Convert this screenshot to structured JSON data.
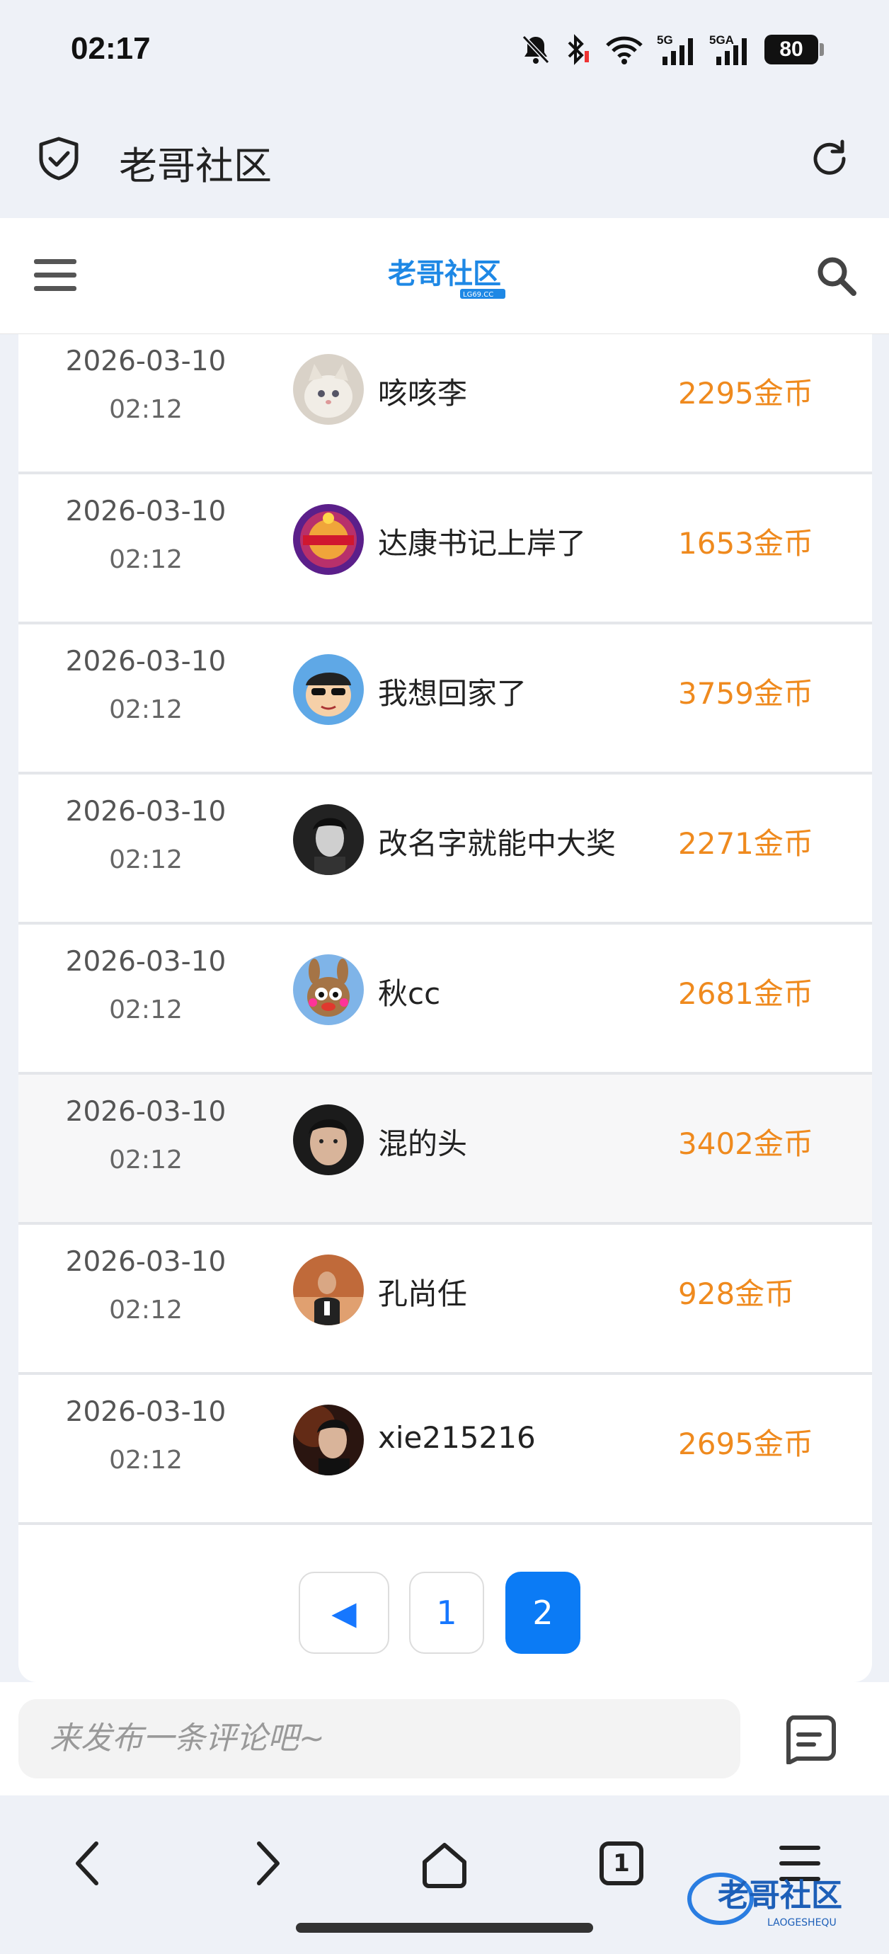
{
  "status_bar": {
    "time": "02:17",
    "battery": "80",
    "signal_a": "5G",
    "signal_b": "5GA"
  },
  "browser": {
    "title": "老哥社区"
  },
  "site_header": {
    "logo_text": "老哥社区",
    "logo_sub": "LG69.CC"
  },
  "rows": [
    {
      "date": "2026-03-10",
      "time": "02:12",
      "user": "咳咳李",
      "coins": "2295金币",
      "avatar": "cat-avatar",
      "highlight": false
    },
    {
      "date": "2026-03-10",
      "time": "02:12",
      "user": "达康书记上岸了",
      "coins": "1653金币",
      "avatar": "purple-badge-avatar",
      "highlight": false
    },
    {
      "date": "2026-03-10",
      "time": "02:12",
      "user": "我想回家了",
      "coins": "3759金币",
      "avatar": "cartoon-boy-avatar",
      "highlight": false
    },
    {
      "date": "2026-03-10",
      "time": "02:12",
      "user": "改名字就能中大奖",
      "coins": "2271金币",
      "avatar": "dark-photo-avatar",
      "highlight": false
    },
    {
      "date": "2026-03-10",
      "time": "02:12",
      "user": "秋cc",
      "coins": "2681金币",
      "avatar": "rabbit-avatar",
      "highlight": false
    },
    {
      "date": "2026-03-10",
      "time": "02:12",
      "user": "混的头",
      "coins": "3402金币",
      "avatar": "face-photo-avatar",
      "highlight": true
    },
    {
      "date": "2026-03-10",
      "time": "02:12",
      "user": "孔尚任",
      "coins": "928金币",
      "avatar": "man-photo-avatar",
      "highlight": false
    },
    {
      "date": "2026-03-10",
      "time": "02:12",
      "user": "xie215216",
      "coins": "2695金币",
      "avatar": "portrait-avatar",
      "highlight": false
    }
  ],
  "pager": {
    "prev": "◀",
    "pages": [
      "1",
      "2"
    ],
    "current": "2"
  },
  "comment": {
    "placeholder": "来发布一条评论吧~"
  },
  "nav": {
    "tab_count": "1"
  },
  "watermark": {
    "text": "老哥社区",
    "sub": "LAOGESHEQU"
  },
  "colors": {
    "accent": "#0b7bf5",
    "coins": "#ef8a1e"
  }
}
